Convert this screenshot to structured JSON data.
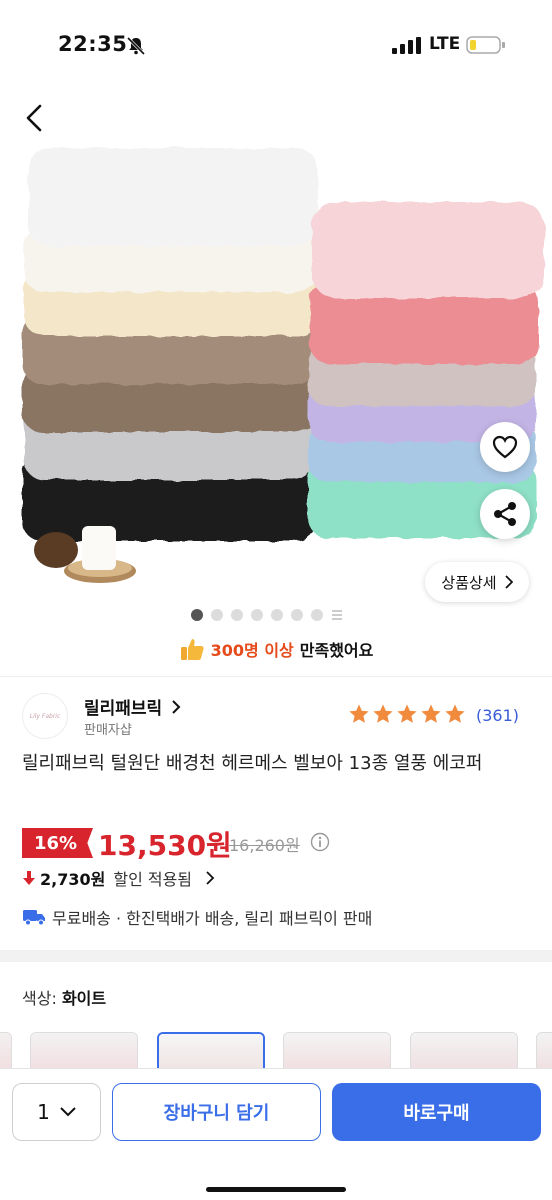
{
  "status_bar": {
    "time": "22:35",
    "network": "LTE"
  },
  "hero": {
    "detail_button": "상품상세",
    "pager": {
      "count": 7,
      "active_index": 0
    }
  },
  "satisfaction": {
    "highlight": "300명 이상",
    "rest": "만족했어요"
  },
  "seller": {
    "logo_text": "Lily Fabric",
    "name": "릴리패브릭",
    "type": "판매자샵",
    "rating": 5,
    "review_count": "(361)"
  },
  "product": {
    "title": "릴리패브릭 털원단 배경천 헤르메스 벨보아 13종 열풍 에코퍼",
    "discount_rate": "16%",
    "price": "13,530원",
    "original_price": "16,260원",
    "discount_amount": "2,730원",
    "discount_label": "할인 적용됨",
    "shipping": "무료배송 · 한진택배가 배송, 릴리 패브릭이 판매"
  },
  "option": {
    "label": "색상:",
    "value": "화이트"
  },
  "bottom_bar": {
    "quantity": "1",
    "cart_label": "장바구니 담기",
    "buy_label": "바로구매"
  },
  "colors": {
    "accent": "#3a6ee8",
    "sale": "#d8242c",
    "highlight": "#e54b1a"
  }
}
